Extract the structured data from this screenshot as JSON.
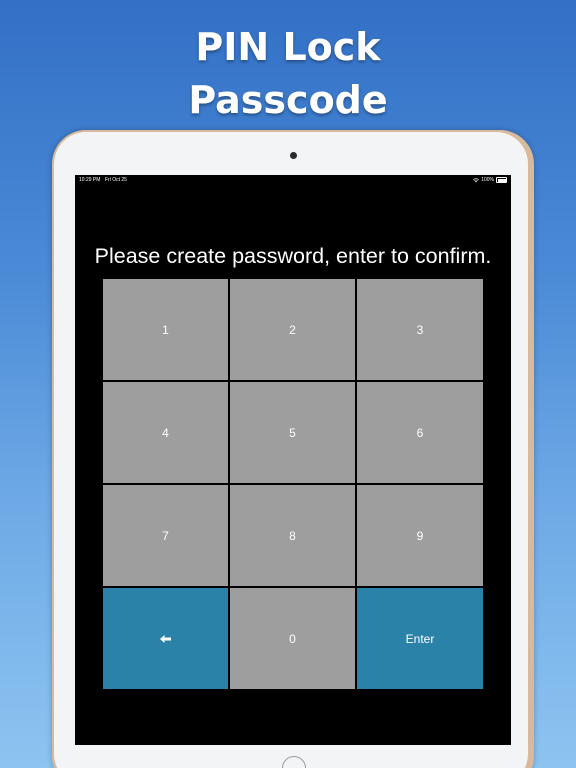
{
  "promo": {
    "title_line1": "PIN Lock",
    "title_line2": "Passcode"
  },
  "status_bar": {
    "time": "10:29 PM",
    "date": "Fri Oct 25",
    "battery": "100%"
  },
  "prompt": "Please create password, enter to confirm.",
  "keypad": {
    "keys": [
      {
        "label": "1"
      },
      {
        "label": "2"
      },
      {
        "label": "3"
      },
      {
        "label": "4"
      },
      {
        "label": "5"
      },
      {
        "label": "6"
      },
      {
        "label": "7"
      },
      {
        "label": "8"
      },
      {
        "label": "9"
      },
      {
        "label": "🠔",
        "icon": "backspace-arrow-icon"
      },
      {
        "label": "0"
      },
      {
        "label": "Enter"
      }
    ]
  },
  "colors": {
    "key_gray": "#9e9e9e",
    "key_accent": "#2a82a8",
    "screen_bg": "#000000",
    "background_top": "#3370c6",
    "background_bottom": "#8cc4f0"
  }
}
